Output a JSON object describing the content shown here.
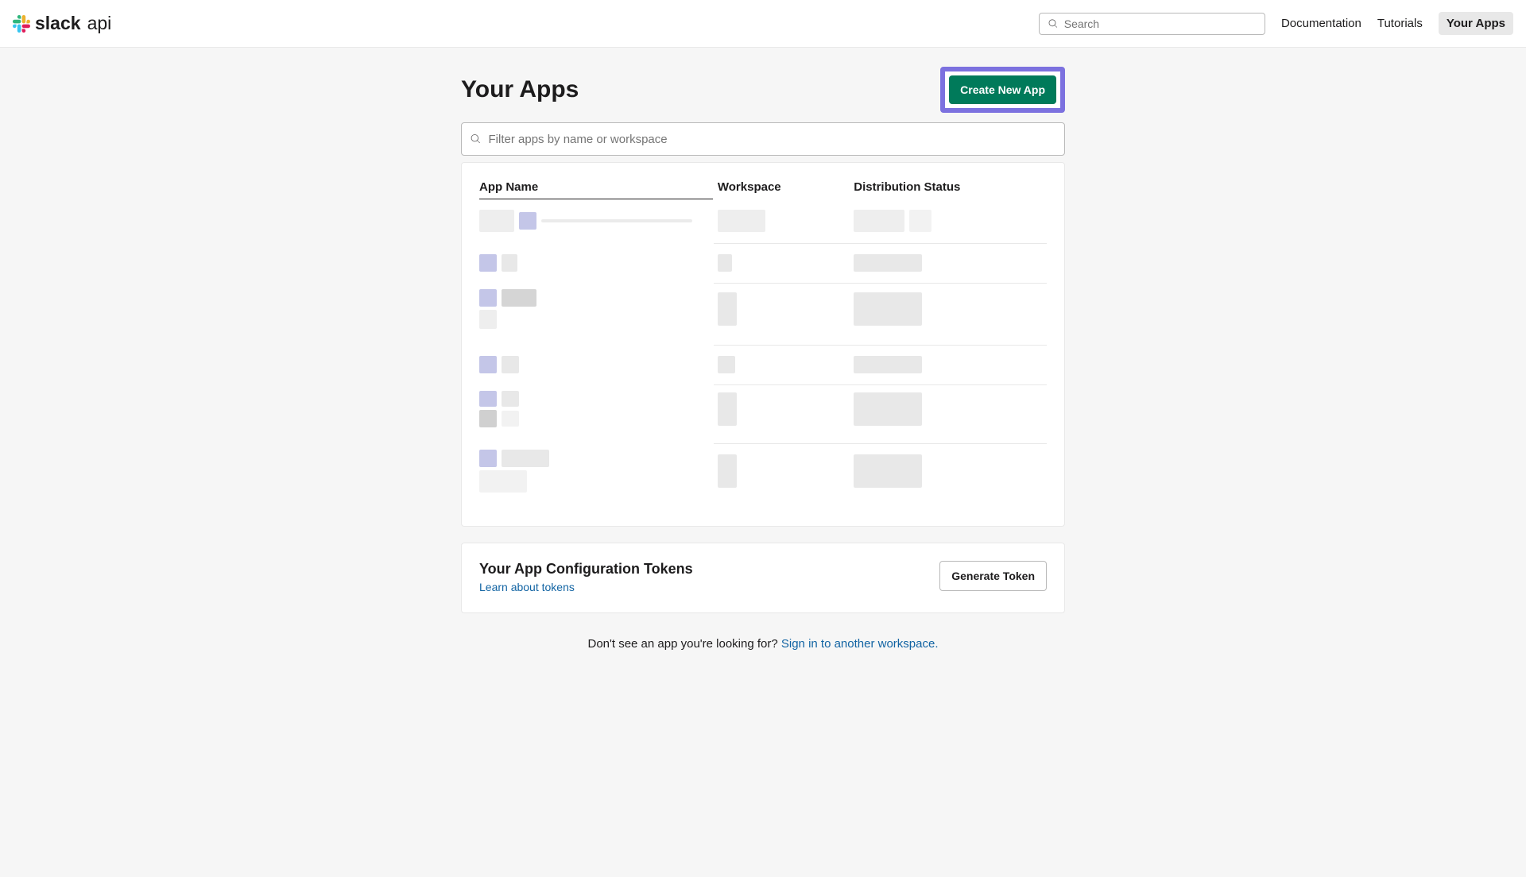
{
  "header": {
    "logo_brand": "slack",
    "logo_product": "api",
    "search_placeholder": "Search",
    "nav": {
      "documentation": "Documentation",
      "tutorials": "Tutorials",
      "your_apps": "Your Apps"
    }
  },
  "page": {
    "title": "Your Apps",
    "create_button": "Create New App",
    "filter_placeholder": "Filter apps by name or workspace"
  },
  "table": {
    "columns": {
      "app_name": "App Name",
      "workspace": "Workspace",
      "distribution_status": "Distribution Status"
    }
  },
  "tokens": {
    "title": "Your App Configuration Tokens",
    "learn_link": "Learn about tokens",
    "generate_button": "Generate Token"
  },
  "footer": {
    "text": "Don't see an app you're looking for? ",
    "link": "Sign in to another workspace."
  }
}
